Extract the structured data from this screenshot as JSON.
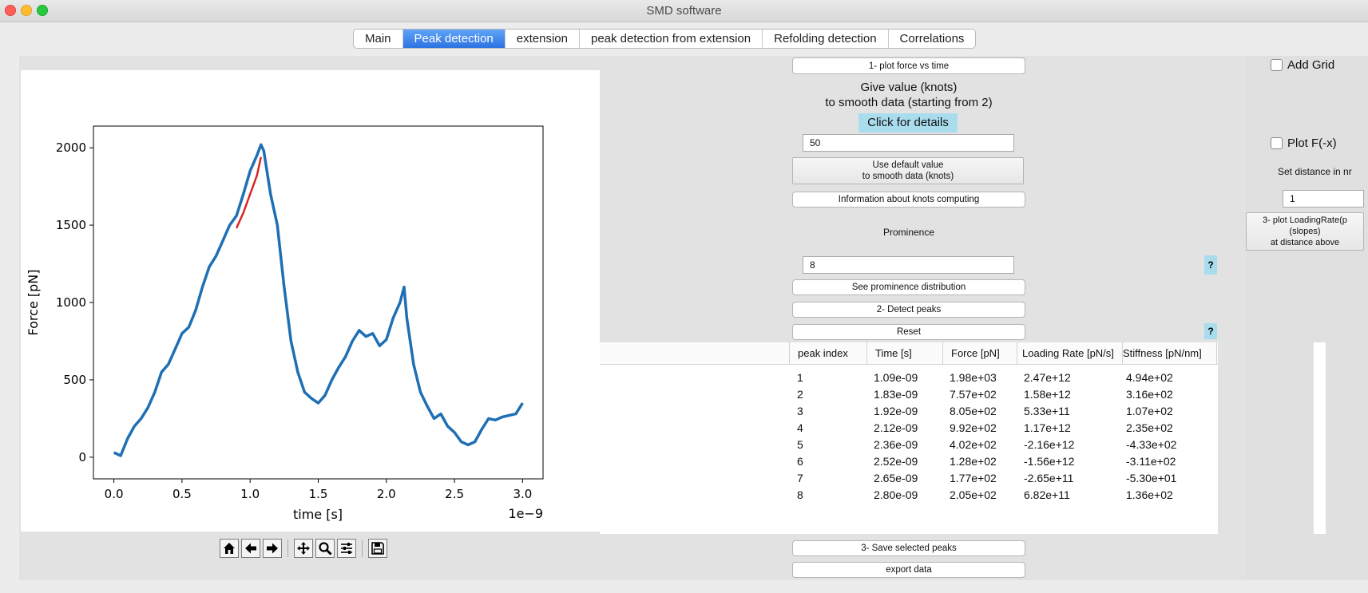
{
  "window": {
    "title": "SMD software"
  },
  "tabs": [
    {
      "label": "Main",
      "active": false
    },
    {
      "label": "Peak detection",
      "active": true
    },
    {
      "label": "extension",
      "active": false
    },
    {
      "label": "peak detection from extension",
      "active": false
    },
    {
      "label": "Refolding detection",
      "active": false
    },
    {
      "label": "Correlations",
      "active": false
    }
  ],
  "controls": {
    "plot_force_time": "1- plot force vs time",
    "smooth_label": "Give value (knots)\nto smooth data (starting from 2)",
    "click_details": "Click for details",
    "knots_value": "50",
    "default_value_btn": "Use default value\nto smooth data (knots)",
    "knots_info_btn": "Information about knots computing",
    "prominence_label": "Prominence",
    "prominence_value": "8",
    "help_q": "?",
    "prominence_dist_btn": "See prominence distribution",
    "detect_peaks_btn": "2- Detect peaks",
    "reset_btn": "Reset",
    "save_peaks_btn": "3- Save selected peaks",
    "export_btn": "export data"
  },
  "right_panel": {
    "add_grid": "Add Grid",
    "plot_fx": "Plot F(-x)",
    "set_distance": "Set distance in nr",
    "distance_value": "1",
    "loading_rate_btn": "3- plot LoadingRate(p\n(slopes)\nat distance above"
  },
  "table": {
    "headers": [
      "peak index",
      "Time [s]",
      "Force [pN]",
      "Loading Rate [pN/s]",
      "Stiffness [pN/nm]"
    ],
    "rows": [
      [
        "1",
        "1.09e-09",
        "1.98e+03",
        "2.47e+12",
        "4.94e+02"
      ],
      [
        "2",
        "1.83e-09",
        "7.57e+02",
        "1.58e+12",
        "3.16e+02"
      ],
      [
        "3",
        "1.92e-09",
        "8.05e+02",
        "5.33e+11",
        "1.07e+02"
      ],
      [
        "4",
        "2.12e-09",
        "9.92e+02",
        "1.17e+12",
        "2.35e+02"
      ],
      [
        "5",
        "2.36e-09",
        "4.02e+02",
        "-2.16e+12",
        "-4.33e+02"
      ],
      [
        "6",
        "2.52e-09",
        "1.28e+02",
        "-1.56e+12",
        "-3.11e+02"
      ],
      [
        "7",
        "2.65e-09",
        "1.77e+02",
        "-2.65e+11",
        "-5.30e+01"
      ],
      [
        "8",
        "2.80e-09",
        "2.05e+02",
        "6.82e+11",
        "1.36e+02"
      ]
    ]
  },
  "toolbar_icons": [
    "home-icon",
    "back-arrow-icon",
    "forward-arrow-icon",
    "pan-icon",
    "zoom-icon",
    "configure-subplots-icon",
    "save-icon"
  ],
  "chart_data": {
    "type": "line",
    "xlabel": "time [s]",
    "ylabel": "Force [pN]",
    "x_offset_text": "1e−9",
    "xlim": [
      -0.15,
      3.15
    ],
    "ylim": [
      -140,
      2140
    ],
    "xticks": [
      0.0,
      0.5,
      1.0,
      1.5,
      2.0,
      2.5,
      3.0
    ],
    "xtick_labels": [
      "0.0",
      "0.5",
      "1.0",
      "1.5",
      "2.0",
      "2.5",
      "3.0"
    ],
    "yticks": [
      0,
      500,
      1000,
      1500,
      2000
    ],
    "ytick_labels": [
      "0",
      "500",
      "1000",
      "1500",
      "2000"
    ],
    "grid": false,
    "series": [
      {
        "color": "#1f6fb4",
        "x": [
          0.0,
          0.05,
          0.1,
          0.15,
          0.2,
          0.25,
          0.3,
          0.35,
          0.4,
          0.45,
          0.5,
          0.55,
          0.6,
          0.65,
          0.7,
          0.75,
          0.8,
          0.85,
          0.9,
          0.95,
          1.0,
          1.05,
          1.08,
          1.1,
          1.15,
          1.2,
          1.25,
          1.3,
          1.35,
          1.4,
          1.45,
          1.5,
          1.55,
          1.6,
          1.65,
          1.7,
          1.75,
          1.8,
          1.85,
          1.9,
          1.95,
          2.0,
          2.05,
          2.1,
          2.13,
          2.15,
          2.2,
          2.25,
          2.3,
          2.35,
          2.4,
          2.45,
          2.5,
          2.55,
          2.6,
          2.65,
          2.7,
          2.75,
          2.8,
          2.85,
          2.9,
          2.95,
          3.0
        ],
        "y": [
          30,
          10,
          120,
          200,
          250,
          320,
          420,
          550,
          600,
          700,
          800,
          840,
          950,
          1100,
          1230,
          1300,
          1400,
          1500,
          1560,
          1700,
          1850,
          1950,
          2020,
          1980,
          1700,
          1500,
          1100,
          750,
          550,
          420,
          380,
          350,
          400,
          500,
          580,
          650,
          750,
          820,
          780,
          800,
          720,
          760,
          900,
          1000,
          1100,
          900,
          600,
          420,
          330,
          250,
          280,
          200,
          160,
          100,
          80,
          100,
          180,
          250,
          240,
          260,
          270,
          280,
          350
        ]
      },
      {
        "color": "#d62728",
        "x": [
          0.9,
          0.95,
          1.0,
          1.05,
          1.08
        ],
        "y": [
          1480,
          1580,
          1700,
          1820,
          1940
        ]
      }
    ]
  }
}
